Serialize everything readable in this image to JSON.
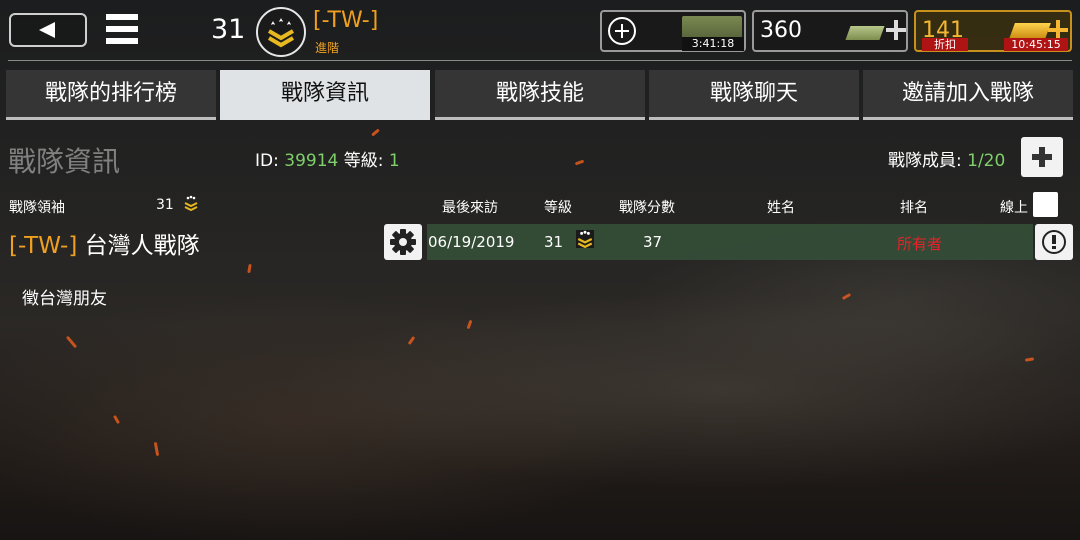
{
  "topbar": {
    "player_level": "31",
    "clan_tag": "[-TW-]",
    "rank_name": "進階"
  },
  "resources": {
    "timer_crate": "3:41:18",
    "cash": "360",
    "gold": "141",
    "discount_label": "折扣",
    "discount_timer": "10:45:15"
  },
  "tabs": [
    "戰隊的排行榜",
    "戰隊資訊",
    "戰隊技能",
    "戰隊聊天",
    "邀請加入戰隊"
  ],
  "info": {
    "section_title": "戰隊資訊",
    "id_label": "ID:",
    "id_value": "39914",
    "level_label": "等級:",
    "level_value": "1",
    "members_label": "戰隊成員:",
    "members_value": "1/20"
  },
  "leader": {
    "label": "戰隊領袖",
    "level": "31"
  },
  "clan": {
    "tag": "[-TW-]",
    "name": "台灣人戰隊",
    "description": "徵台灣朋友"
  },
  "table": {
    "headers": {
      "last_visit": "最後來訪",
      "level": "等級",
      "score": "戰隊分數",
      "name": "姓名",
      "rank": "排名",
      "online": "線上"
    },
    "rows": [
      {
        "last_visit": "06/19/2019",
        "level": "31",
        "score": "37",
        "name": "",
        "rank": "所有者"
      }
    ]
  },
  "colors": {
    "accent_orange": "#f0a020",
    "value_green": "#7fcf6a",
    "owner_red": "#e8202a",
    "row_green": "#344e37"
  },
  "icons": [
    "back-arrow-icon",
    "menu-icon",
    "rank-chevron-icon",
    "plus-circle-icon",
    "crate-icon",
    "cash-icon",
    "gold-icon",
    "plus-icon",
    "gear-icon",
    "info-icon"
  ]
}
